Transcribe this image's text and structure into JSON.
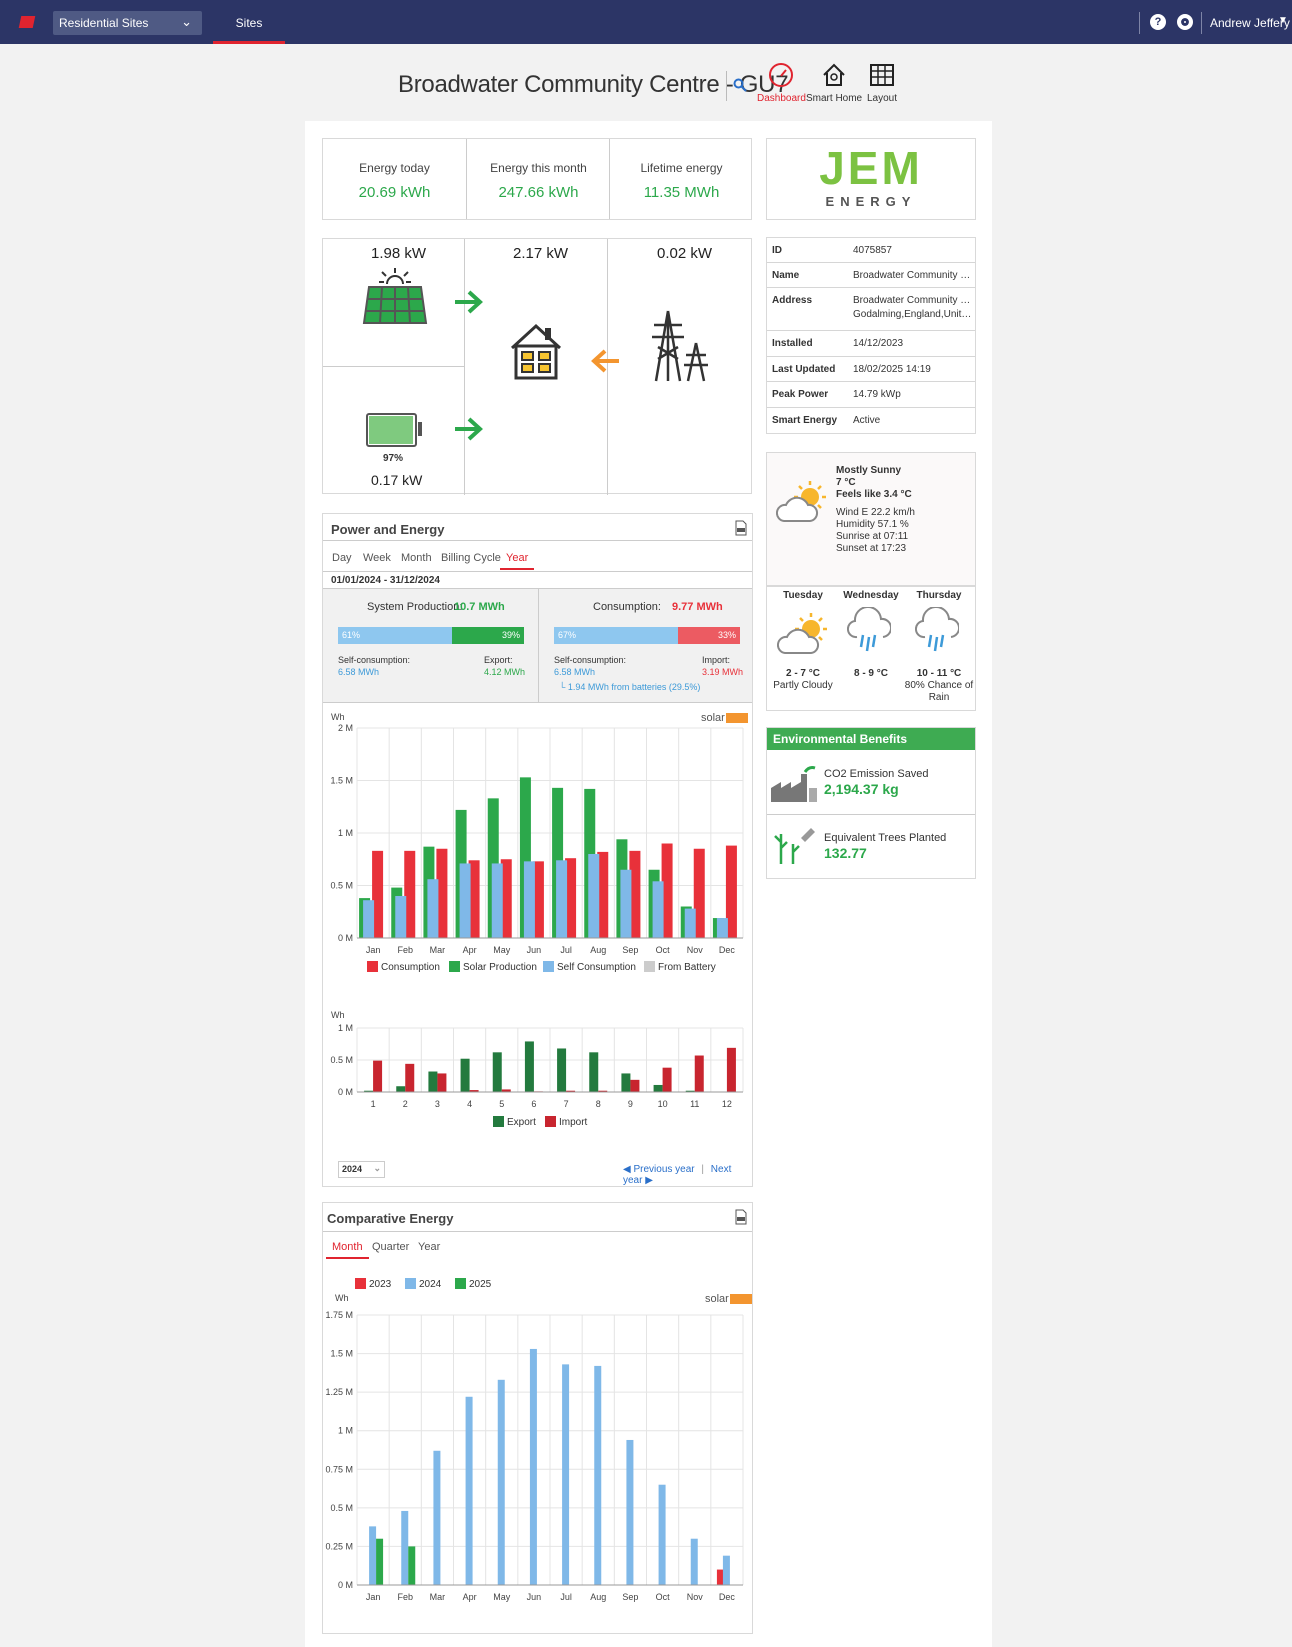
{
  "topbar": {
    "site_selector": "Residential Sites",
    "tab_sites": "Sites",
    "help_icon": "question-icon",
    "support_icon": "lifebuoy-icon",
    "user_name": "Andrew Jeffery"
  },
  "header": {
    "title": "Broadwater Community Centre - GU7",
    "nav": [
      {
        "label": "Dashboard",
        "icon": "speedometer-icon",
        "active": true
      },
      {
        "label": "Smart Home",
        "icon": "house-icon",
        "active": false
      },
      {
        "label": "Layout",
        "icon": "grid-icon",
        "active": false
      }
    ]
  },
  "energy_summary": {
    "today_label": "Energy today",
    "today_value": "20.69 kWh",
    "month_label": "Energy this month",
    "month_value": "247.66 kWh",
    "lifetime_label": "Lifetime energy",
    "lifetime_value": "11.35 MWh"
  },
  "power_flow": {
    "solar_kw": "1.98 kW",
    "home_kw": "2.17 kW",
    "grid_kw": "0.02 kW",
    "battery_pct": "97%",
    "battery_kw": "0.17 kW",
    "battery_level": 0.97
  },
  "brand": {
    "logo_top": "JEM",
    "logo_bottom": "ENERGY",
    "color": "#7cc242"
  },
  "site_info": [
    {
      "k": "ID",
      "v": "4075857"
    },
    {
      "k": "Name",
      "v": "Broadwater Community Centr..."
    },
    {
      "k": "Address",
      "v": "Broadwater Community Centr...",
      "v2": "Godalming,England,United Ki..."
    },
    {
      "k": "Installed",
      "v": "14/12/2023"
    },
    {
      "k": "Last Updated",
      "v": "18/02/2025 14:19"
    },
    {
      "k": "Peak Power",
      "v": "14.79 kWp"
    },
    {
      "k": "Smart Energy",
      "v": "Active"
    }
  ],
  "weather": {
    "condition": "Mostly Sunny",
    "temp": "7 °C",
    "feels": "Feels like 3.4 °C",
    "wind": "Wind E 22.2 km/h",
    "humidity": "Humidity 57.1 %",
    "sunrise": "Sunrise at 07:11",
    "sunset": "Sunset at 17:23",
    "forecast": [
      {
        "day": "Tuesday",
        "temp": "2 - 7 °C",
        "desc": "Partly Cloudy",
        "desc2": ""
      },
      {
        "day": "Wednesday",
        "temp": "8 - 9 °C",
        "desc": "",
        "desc2": ""
      },
      {
        "day": "Thursday",
        "temp": "10 - 11 °C",
        "desc": "80% Chance of",
        "desc2": "Rain"
      }
    ]
  },
  "environment": {
    "title": "Environmental Benefits",
    "co2_label": "CO2 Emission Saved",
    "co2_value": "2,194.37 kg",
    "trees_label": "Equivalent Trees Planted",
    "trees_value": "132.77"
  },
  "power_energy": {
    "title": "Power and Energy",
    "tabs": [
      "Day",
      "Week",
      "Month",
      "Billing Cycle",
      "Year"
    ],
    "active_tab": "Year",
    "date_range": "01/01/2024 - 31/12/2024",
    "production_label": "System Production:",
    "production_value": "10.7 MWh",
    "consumption_label": "Consumption:",
    "consumption_value": "9.77 MWh",
    "prod_self_pct": "61%",
    "prod_export_pct": "39%",
    "cons_self_pct": "67%",
    "cons_import_pct": "33%",
    "self_cons_label": "Self-consumption:",
    "self_cons_value": "6.58 MWh",
    "export_label": "Export:",
    "export_value": "4.12 MWh",
    "import_label": "Import:",
    "import_value": "3.19 MWh",
    "battery_note": "└ 1.94 MWh from batteries (29.5%)",
    "solar_brand": "solar",
    "year_select": "2024",
    "prev_year": "Previous year",
    "next_year": "Next year",
    "sep": "|"
  },
  "chart_data": [
    {
      "type": "bar",
      "ylabel": "Wh",
      "ylim": [
        0,
        2000000
      ],
      "yticks": [
        "0 M",
        "0.5 M",
        "1 M",
        "1.5 M",
        "2 M"
      ],
      "categories": [
        "Jan",
        "Feb",
        "Mar",
        "Apr",
        "May",
        "Jun",
        "Jul",
        "Aug",
        "Sep",
        "Oct",
        "Nov",
        "Dec"
      ],
      "series": [
        {
          "name": "Consumption",
          "color": "#e8313a",
          "values": [
            830000,
            830000,
            850000,
            740000,
            750000,
            730000,
            760000,
            820000,
            830000,
            900000,
            850000,
            880000
          ]
        },
        {
          "name": "Solar Production",
          "color": "#2ca84b",
          "values": [
            380000,
            480000,
            870000,
            1220000,
            1330000,
            1530000,
            1430000,
            1420000,
            940000,
            650000,
            300000,
            190000
          ]
        },
        {
          "name": "Self Consumption",
          "color": "#7fb8e8",
          "values": [
            360000,
            400000,
            560000,
            710000,
            710000,
            730000,
            740000,
            800000,
            650000,
            540000,
            280000,
            190000
          ]
        },
        {
          "name": "From Battery",
          "color": "#cccccc",
          "values": []
        }
      ]
    },
    {
      "type": "bar",
      "ylabel": "Wh",
      "ylim": [
        0,
        1000000
      ],
      "yticks": [
        "0 M",
        "0.5 M",
        "1 M"
      ],
      "categories": [
        "1",
        "2",
        "3",
        "4",
        "5",
        "6",
        "7",
        "8",
        "9",
        "10",
        "11",
        "12"
      ],
      "series": [
        {
          "name": "Export",
          "color": "#237a3e",
          "values": [
            20000,
            90000,
            320000,
            520000,
            620000,
            790000,
            680000,
            620000,
            290000,
            110000,
            20000,
            0
          ]
        },
        {
          "name": "Import",
          "color": "#c8252f",
          "values": [
            490000,
            440000,
            290000,
            30000,
            40000,
            10000,
            20000,
            20000,
            190000,
            380000,
            570000,
            690000
          ]
        }
      ]
    },
    {
      "type": "bar",
      "title": "Comparative Energy",
      "ylabel": "Wh",
      "ylim": [
        0,
        1750000
      ],
      "yticks": [
        "0 M",
        "0.25 M",
        "0.5 M",
        "0.75 M",
        "1 M",
        "1.25 M",
        "1.5 M",
        "1.75 M"
      ],
      "categories": [
        "Jan",
        "Feb",
        "Mar",
        "Apr",
        "May",
        "Jun",
        "Jul",
        "Aug",
        "Sep",
        "Oct",
        "Nov",
        "Dec"
      ],
      "series": [
        {
          "name": "2023",
          "color": "#e8313a",
          "values": [
            0,
            0,
            0,
            0,
            0,
            0,
            0,
            0,
            0,
            0,
            0,
            100000
          ]
        },
        {
          "name": "2024",
          "color": "#7fb8e8",
          "values": [
            380000,
            480000,
            870000,
            1220000,
            1330000,
            1530000,
            1430000,
            1420000,
            940000,
            650000,
            300000,
            190000
          ]
        },
        {
          "name": "2025",
          "color": "#2ca84b",
          "values": [
            300000,
            250000,
            0,
            0,
            0,
            0,
            0,
            0,
            0,
            0,
            0,
            0
          ]
        }
      ]
    }
  ],
  "comparative": {
    "title": "Comparative Energy",
    "tabs": [
      "Month",
      "Quarter",
      "Year"
    ],
    "active_tab": "Month",
    "solar_brand": "solar"
  }
}
